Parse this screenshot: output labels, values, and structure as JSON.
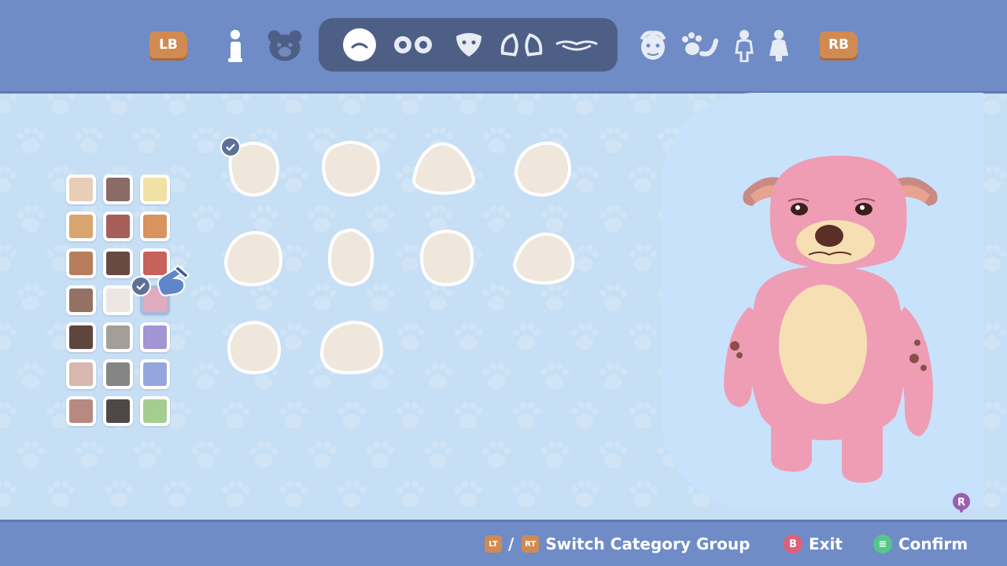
{
  "top_bar": {
    "lb_label": "LB",
    "rb_label": "RB",
    "left_icons": [
      "info-icon",
      "bear-head-icon"
    ],
    "group_icons": [
      "head-shape-icon",
      "eyes-icon",
      "nose-icon",
      "ears-icon",
      "mouth-icon"
    ],
    "right_icons": [
      "face-markings-icon",
      "paws-tail-icon",
      "body-icon",
      "outfit-icon"
    ],
    "active_group_icon": "head-shape-icon"
  },
  "palette": {
    "colors": [
      [
        "#e9cdb6",
        "#8a6b66",
        "#f0e2a2"
      ],
      [
        "#d9a56f",
        "#a75e58",
        "#d9935e"
      ],
      [
        "#b87d5b",
        "#6a4942",
        "#c6625a"
      ],
      [
        "#947263",
        "#ede6e2",
        "#e59fb2"
      ],
      [
        "#5e453d",
        "#a59e98",
        "#a394d4"
      ],
      [
        "#d8b7ae",
        "#858585",
        "#95a6de"
      ],
      [
        "#b68a80",
        "#4e4946",
        "#a4cd8f"
      ]
    ],
    "selected": "#e59fb2",
    "cursor_icon": "pointing-glove-icon"
  },
  "head_shapes": {
    "count": 10,
    "selected_index": 0,
    "fill_color": "#efe6dc"
  },
  "character": {
    "body_color": "#ee9db5",
    "belly_color": "#f7dfb4",
    "ear_inner_color": "#e6a38f"
  },
  "bottom_bar": {
    "lt_label": "LT",
    "separator": "/",
    "rt_label": "RT",
    "switch_label": "Switch Category Group",
    "b_label": "B",
    "exit_label": "Exit",
    "confirm_symbol": "≡",
    "confirm_label": "Confirm",
    "r_label": "R"
  },
  "colors": {
    "bar": "#6f8cc7",
    "background": "#c6dff5",
    "button_orange": "#d08a52",
    "b_button": "#e05f7a",
    "confirm_button": "#57c48a"
  }
}
